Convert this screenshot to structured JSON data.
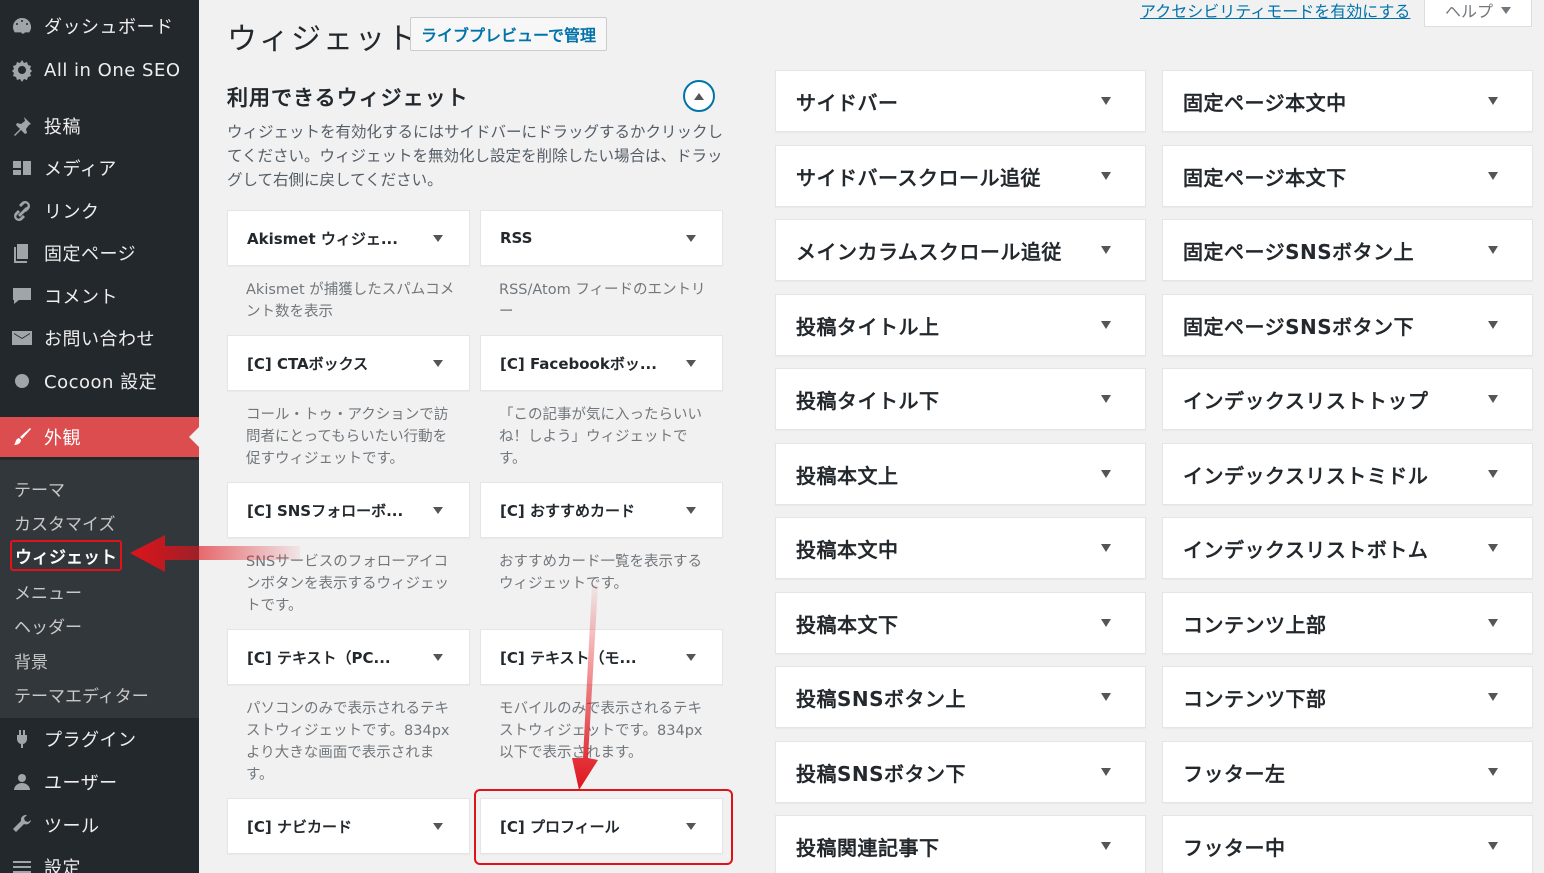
{
  "sidebar": {
    "top_items": [
      {
        "label": "ダッシュボード",
        "icon": "dashboard-icon"
      },
      {
        "label": "All in One SEO",
        "icon": "gear-icon"
      },
      {
        "label": "投稿",
        "icon": "pin-icon"
      },
      {
        "label": "メディア",
        "icon": "media-icon"
      },
      {
        "label": "リンク",
        "icon": "link-icon"
      },
      {
        "label": "固定ページ",
        "icon": "page-icon"
      },
      {
        "label": "コメント",
        "icon": "comment-icon"
      },
      {
        "label": "お問い合わせ",
        "icon": "mail-icon"
      },
      {
        "label": "Cocoon 設定",
        "icon": "circle-icon"
      }
    ],
    "active_item": {
      "label": "外観",
      "icon": "brush-icon"
    },
    "submenu": [
      "テーマ",
      "カスタマイズ",
      "ウィジェット",
      "メニュー",
      "ヘッダー",
      "背景",
      "テーマエディター"
    ],
    "bottom_items": [
      {
        "label": "プラグイン",
        "icon": "plugin-icon"
      },
      {
        "label": "ユーザー",
        "icon": "user-icon"
      },
      {
        "label": "ツール",
        "icon": "wrench-icon"
      },
      {
        "label": "設定",
        "icon": "settings-icon"
      }
    ],
    "active_color": "#dc4d4f"
  },
  "header": {
    "title": "ウィジェット",
    "live_preview_label": "ライブプレビューで管理",
    "accessibility_link": "アクセシビリティモードを有効にする",
    "help_label": "ヘルプ"
  },
  "available": {
    "title": "利用できるウィジェット",
    "description": "ウィジェットを有効化するにはサイドバーにドラッグするかクリックしてください。ウィジェットを無効化し設定を削除したい場合は、ドラッグして右側に戻してください。",
    "widgets": [
      {
        "title": "Akismet ウィジェ...",
        "desc": "Akismet が捕獲したスパムコメント数を表示"
      },
      {
        "title": "RSS",
        "desc": "RSS/Atom フィードのエントリー"
      },
      {
        "title": "[C] CTAボックス",
        "desc": "コール・トゥ・アクションで訪問者にとってもらいたい行動を促すウィジェットです。"
      },
      {
        "title": "[C] Facebookボッ...",
        "desc": "「この記事が気に入ったらいいね！しよう」ウィジェットです。"
      },
      {
        "title": "[C] SNSフォローボ...",
        "desc": "SNSサービスのフォローアイコンボタンを表示するウィジェットです。"
      },
      {
        "title": "[C] おすすめカード",
        "desc": "おすすめカード一覧を表示するウィジェットです。"
      },
      {
        "title": "[C] テキスト（PC...",
        "desc": "パソコンのみで表示されるテキストウィジェットです。834pxより大きな画面で表示されます。"
      },
      {
        "title": "[C] テキスト（モ...",
        "desc": "モバイルのみで表示されるテキストウィジェットです。834px以下で表示されます。"
      },
      {
        "title": "[C] ナビカード",
        "desc": ""
      },
      {
        "title": "[C] プロフィール",
        "desc": ""
      }
    ]
  },
  "areas_left": [
    "サイドバー",
    "サイドバースクロール追従",
    "メインカラムスクロール追従",
    "投稿タイトル上",
    "投稿タイトル下",
    "投稿本文上",
    "投稿本文中",
    "投稿本文下",
    "投稿SNSボタン上",
    "投稿SNSボタン下",
    "投稿関連記事下"
  ],
  "areas_right": [
    "固定ページ本文中",
    "固定ページ本文下",
    "固定ページSNSボタン上",
    "固定ページSNSボタン下",
    "インデックスリストトップ",
    "インデックスリストミドル",
    "インデックスリストボトム",
    "コンテンツ上部",
    "コンテンツ下部",
    "フッター左",
    "フッター中"
  ],
  "annotation_color": "#e0131b"
}
